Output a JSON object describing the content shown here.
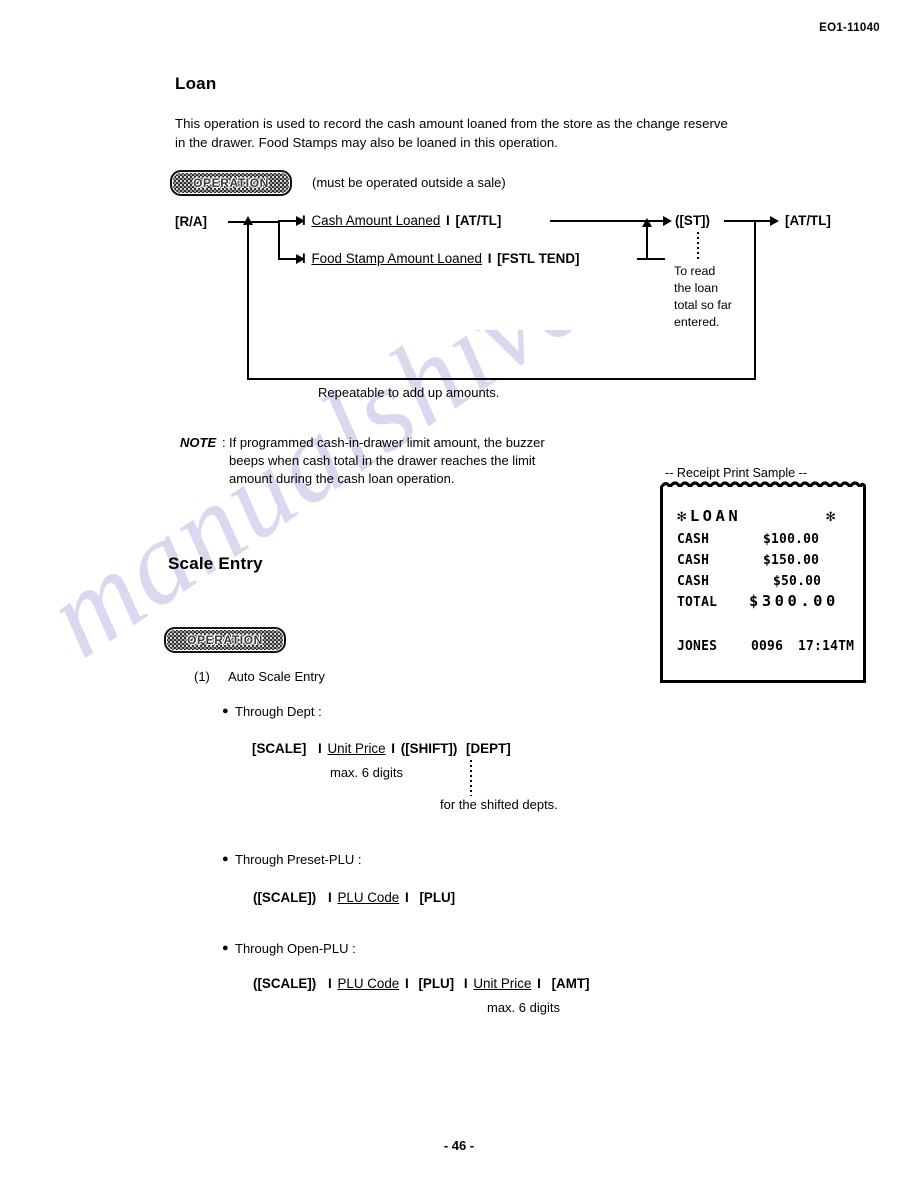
{
  "document": {
    "header_code": "EO1-11040",
    "page_number": "- 46 -",
    "watermark": "manualshive.com"
  },
  "sections": {
    "loan": {
      "heading": "Loan",
      "intro_line1": "This operation is used to record the cash amount loaned from the store as the change reserve",
      "intro_line2": "in the drawer.   Food Stamps may also be loaned in this operation.",
      "operation_badge": "OPERATION",
      "operation_note": "(must be operated outside a sale)",
      "flow": {
        "start_key": "[R/A]",
        "branch1_field": "Cash Amount Loaned",
        "branch1_key": "[AT/TL]",
        "branch2_field": "Food Stamp Amount Loaned",
        "branch2_key": "[FSTL TEND]",
        "st_key": "([ST])",
        "end_key": "[AT/TL]",
        "st_note_l1": "To read",
        "st_note_l2": "the loan",
        "st_note_l3": "total so far",
        "st_note_l4": "entered.",
        "repeat_caption": "Repeatable to add up amounts.",
        "separator": "I"
      },
      "note": {
        "label": "NOTE",
        "colon": ":",
        "line1": "If programmed cash-in-drawer limit amount, the buzzer",
        "line2": "beeps when cash total in the drawer reaches the limit",
        "line3": "amount during the cash loan operation."
      }
    },
    "receipt_sample": {
      "caption": "-- Receipt Print Sample --",
      "title": "✻LOAN",
      "title_right": "✻",
      "rows": [
        {
          "label": "CASH",
          "amount": "$100.00"
        },
        {
          "label": "CASH",
          "amount": "$150.00"
        },
        {
          "label": "CASH",
          "amount": "$50.00"
        }
      ],
      "total_label": "TOTAL",
      "total_amount": "$300.00",
      "footer_clerk": "JONES",
      "footer_counter": "0096",
      "footer_time": "17:14TM"
    },
    "scale_entry": {
      "heading": "Scale Entry",
      "operation_badge": "OPERATION",
      "item1_number": "(1)",
      "item1_label": "Auto Scale Entry",
      "bullet": "●",
      "dept": {
        "title": "Through Dept :",
        "k1": "[SCALE]",
        "sep": "I",
        "f1": "Unit Price",
        "k2": "([SHIFT])",
        "k3": "[DEPT]",
        "max_digits": "max. 6 digits",
        "shift_note": "for the shifted depts."
      },
      "preset_plu": {
        "title": "Through Preset-PLU :",
        "k1": "([SCALE])",
        "sep": "I",
        "f1": "PLU Code",
        "k2": "[PLU]"
      },
      "open_plu": {
        "title": "Through Open-PLU :",
        "k1": "([SCALE])",
        "sep": "I",
        "f1": "PLU Code",
        "k2": "[PLU]",
        "f2": "Unit Price",
        "k3": "[AMT]",
        "max_digits": "max. 6 digits"
      }
    }
  }
}
